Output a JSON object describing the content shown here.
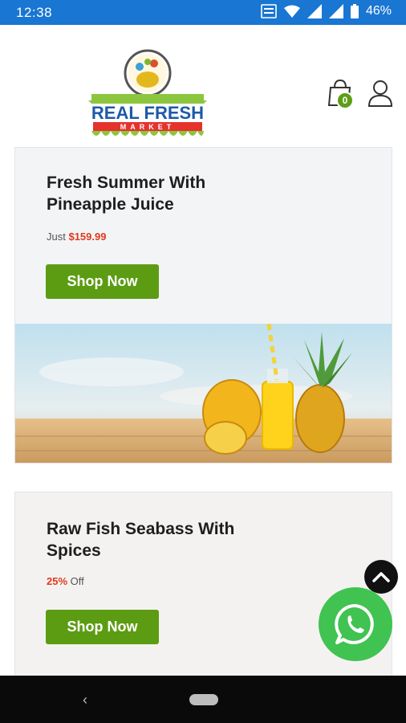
{
  "status_bar": {
    "time": "12:38",
    "battery": "46%"
  },
  "header": {
    "logo_text": "REAL FRESH",
    "logo_subtext": "MARKET",
    "cart_count": "0"
  },
  "banners": [
    {
      "title": "Fresh Summer With Pineapple Juice",
      "prefix": "Just",
      "highlight": "$159.99",
      "suffix": "",
      "button": "Shop Now"
    },
    {
      "title": "Raw Fish Seabass With Spices",
      "prefix": "",
      "highlight": "25%",
      "suffix": "Off",
      "button": "Shop Now"
    }
  ],
  "colors": {
    "status_bar": "#1976d2",
    "accent_green": "#5c9c13",
    "price_red": "#e03a1e",
    "whatsapp": "#40c351"
  },
  "icons": [
    "cart-icon",
    "user-icon",
    "scroll-top-icon",
    "whatsapp-icon",
    "wifi-icon",
    "signal-icon",
    "battery-icon"
  ]
}
